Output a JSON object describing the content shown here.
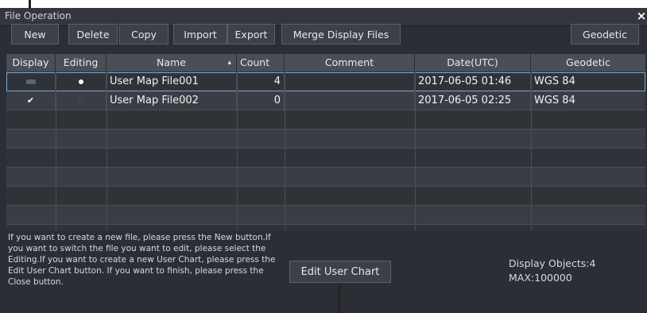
{
  "window": {
    "title": "File Operation",
    "close_label": "×"
  },
  "toolbar": {
    "new": "New",
    "delete": "Delete",
    "copy": "Copy",
    "import": "Import",
    "export": "Export",
    "merge": "Merge Display Files",
    "geodetic": "Geodetic"
  },
  "table": {
    "columns": [
      "Display",
      "Editing",
      "Name",
      "Count",
      "Comment",
      "Date(UTC)",
      "Geodetic"
    ],
    "sort_indicator": "▴",
    "rows": [
      {
        "name": "User Map File001",
        "count": "4",
        "comment": "",
        "date": "2017-06-05 01:46",
        "geodetic": "WGS 84",
        "display_icon": "disk-icon",
        "editing_icon": "dot-icon"
      },
      {
        "name": "User Map File002",
        "count": "0",
        "comment": "",
        "date": "2017-06-05 02:25",
        "geodetic": "WGS 84",
        "display_icon": "check-icon",
        "editing_icon": "lock-icon"
      }
    ]
  },
  "help_text": "If you want to create a new file, please press the New button.If you want to switch the file you want to edit, please select the Editing.If you want to create a new User Chart, please press the Edit User Chart button. If you want to finish, please press the Close button.",
  "edit_user_chart": "Edit User Chart",
  "info": {
    "display_objects": "Display Objects:4",
    "max": "MAX:100000"
  }
}
